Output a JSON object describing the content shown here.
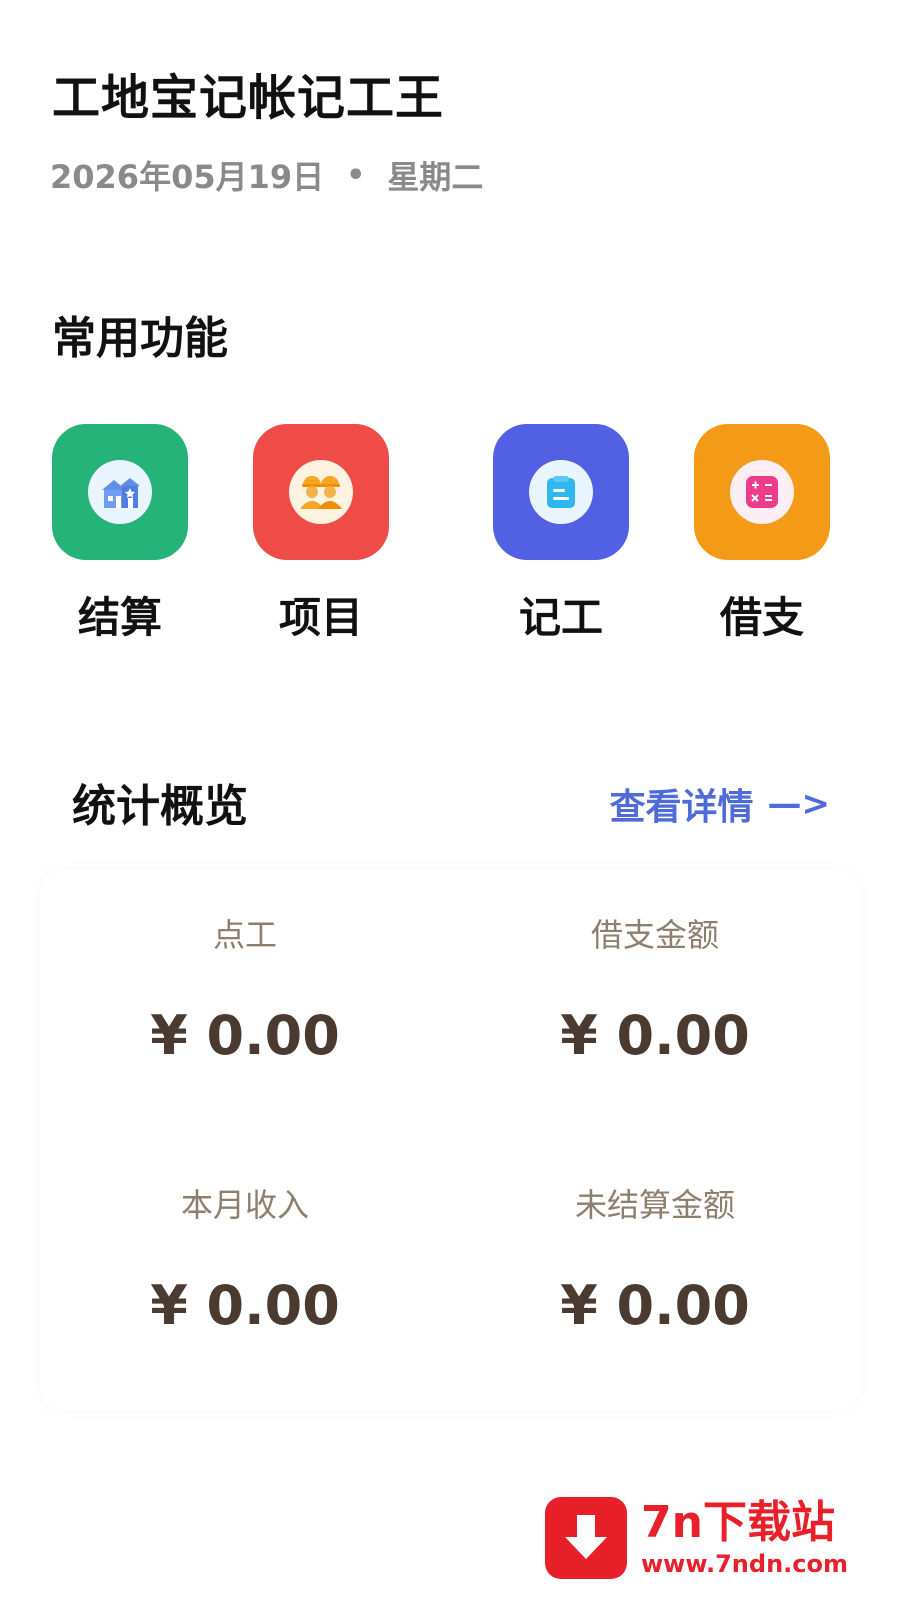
{
  "header": {
    "title": "工地宝记帐记工王",
    "date": "2026年05月19日",
    "separator": "•",
    "weekday": "星期二"
  },
  "functions": {
    "section_title": "常用功能",
    "items": [
      {
        "label": "结算",
        "icon": "house-icon",
        "color": "#25b37a"
      },
      {
        "label": "项目",
        "icon": "workers-icon",
        "color": "#ef4b47"
      },
      {
        "label": "记工",
        "icon": "notebook-icon",
        "color": "#5260e3"
      },
      {
        "label": "借支",
        "icon": "calculator-icon",
        "color": "#f39a16"
      }
    ]
  },
  "stats": {
    "section_title": "统计概览",
    "details_link": "查看详情",
    "details_arrow": "—>",
    "cells": [
      {
        "label": "点工",
        "value": "¥ 0.00"
      },
      {
        "label": "借支金额",
        "value": "¥ 0.00"
      },
      {
        "label": "本月收入",
        "value": "¥ 0.00"
      },
      {
        "label": "未结算金额",
        "value": "¥ 0.00"
      }
    ]
  },
  "watermark": {
    "title": "7n下载站",
    "url": "www.7ndn.com",
    "icon": "download-arrow-icon"
  },
  "colors": {
    "accent_link": "#4f6ad9",
    "value_text": "#4b3a30",
    "label_text": "#8c7f6e"
  }
}
